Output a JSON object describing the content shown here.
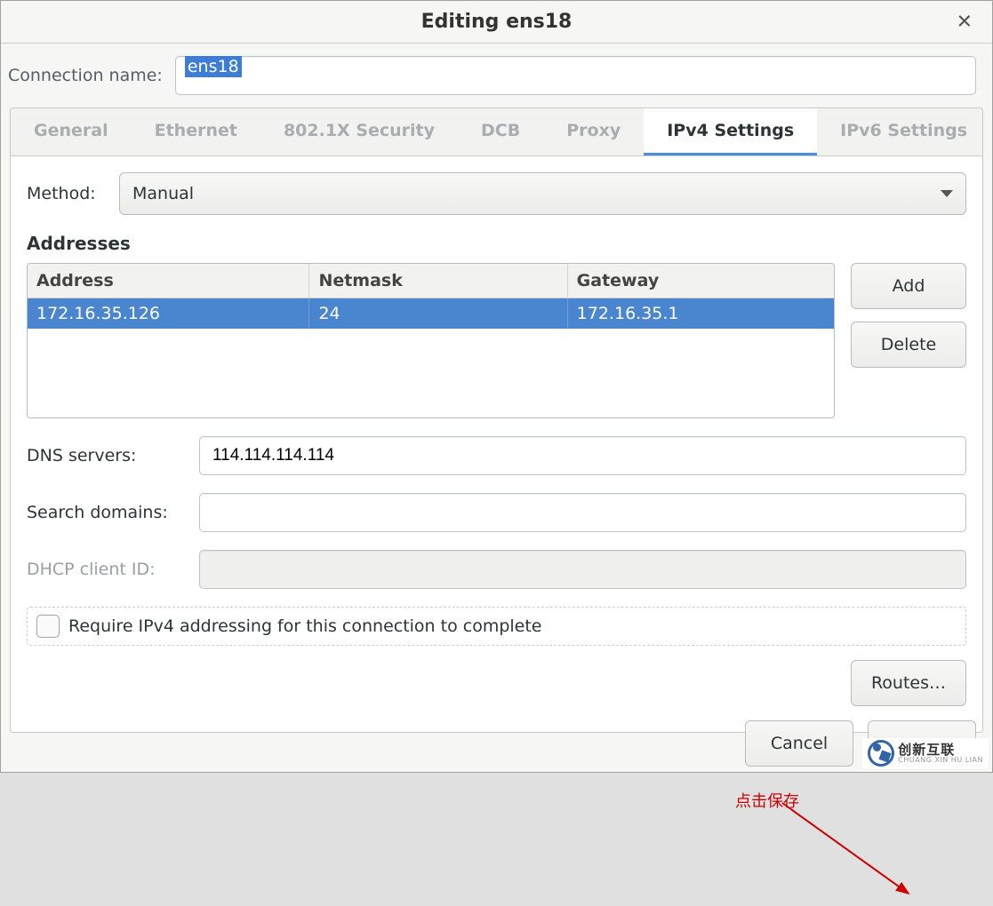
{
  "window": {
    "title": "Editing ens18"
  },
  "connection": {
    "label": "Connection name:",
    "value": "ens18"
  },
  "tabs": {
    "general": "General",
    "ethernet": "Ethernet",
    "security": "802.1X Security",
    "dcb": "DCB",
    "proxy": "Proxy",
    "ipv4": "IPv4 Settings",
    "ipv6": "IPv6 Settings"
  },
  "method": {
    "label": "Method:",
    "value": "Manual"
  },
  "addresses": {
    "section_label": "Addresses",
    "headers": {
      "address": "Address",
      "netmask": "Netmask",
      "gateway": "Gateway"
    },
    "rows": [
      {
        "address": "172.16.35.126",
        "netmask": "24",
        "gateway": "172.16.35.1"
      }
    ],
    "add_btn": "Add",
    "delete_btn": "Delete"
  },
  "dns": {
    "label": "DNS servers:",
    "value": "114.114.114.114"
  },
  "search": {
    "label": "Search domains:",
    "value": ""
  },
  "dhcp": {
    "label": "DHCP client ID:",
    "value": ""
  },
  "require_ipv4": {
    "label": "Require IPv4 addressing for this connection to complete"
  },
  "routes_btn": "Routes…",
  "annotation": "点击保存",
  "footer": {
    "cancel": "Cancel",
    "save": ""
  },
  "watermark": {
    "main": "创新互联",
    "sub": "CHUANG XIN HU LIAN"
  }
}
